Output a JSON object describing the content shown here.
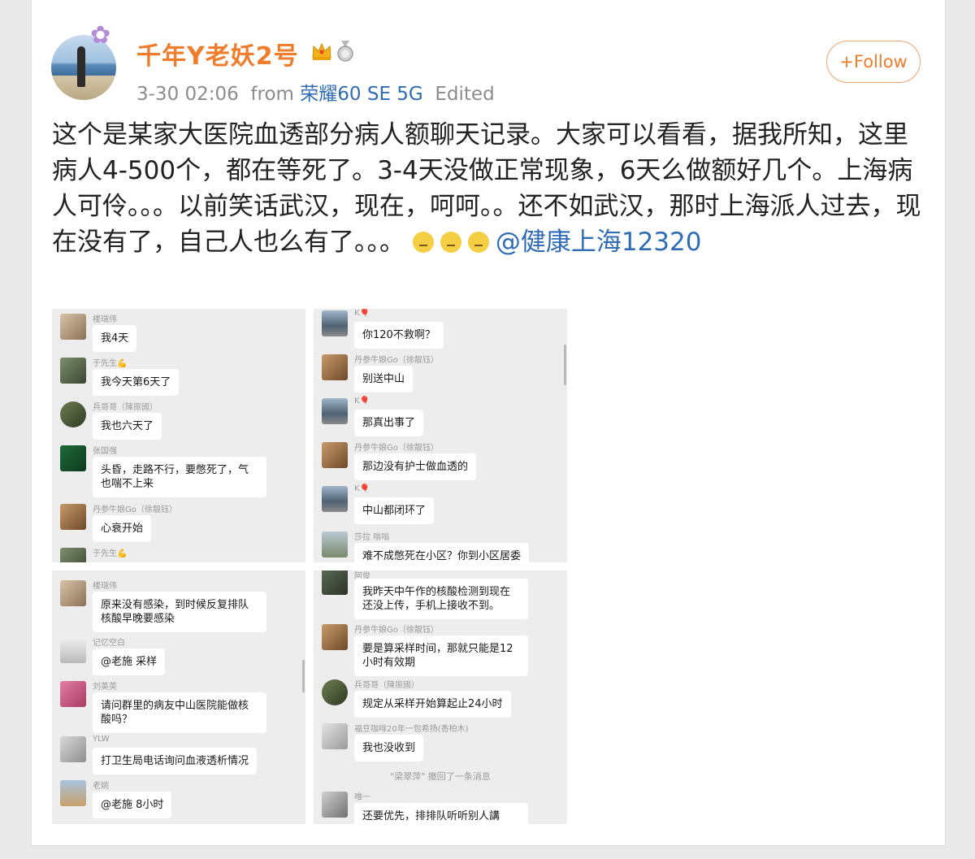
{
  "post": {
    "username": "千年Y老妖2号",
    "time": "3-30 02:06",
    "from_label": "from",
    "source": "荣耀60 SE 5G",
    "edited": "Edited",
    "follow_label": "+Follow",
    "text": "这个是某家大医院血透部分病人额聊天记录。大家可以看看，据我所知，这里病人4-500个，都在等死了。3-4天没做正常现象，6天么做额好几个。上海病人可伶。。。以前笑话武汉，现在，呵呵。。还不如武汉，那时上海派人过去，现在没有了，自己人也么有了。。。",
    "mention": "@健康上海12320"
  },
  "screenshots": [
    {
      "messages": [
        {
          "nick": "楼瑞伟",
          "text": "我4天"
        },
        {
          "nick": "于先生💪",
          "text": "我今天第6天了"
        },
        {
          "nick": "兵哥哥（陳振國）",
          "text": "我也六天了"
        },
        {
          "nick": "张国强",
          "text": "头昏，走路不行，要憋死了，气也喘不上来"
        },
        {
          "nick": "丹参牛娘Go（徐靓钰）",
          "text": "心衰开始"
        },
        {
          "nick": "于先生💪",
          "text": ""
        }
      ]
    },
    {
      "messages": [
        {
          "nick": "K🎈",
          "text": "你120不救啊？"
        },
        {
          "nick": "丹参牛娘Go（徐靓钰）",
          "text": "别送中山"
        },
        {
          "nick": "K🎈",
          "text": "那真出事了"
        },
        {
          "nick": "丹参牛娘Go（徐靓钰）",
          "text": "那边没有护士做血透的"
        },
        {
          "nick": "K🎈",
          "text": "中山都闭环了"
        },
        {
          "nick": "莎拉 嗡嗡",
          "text": "难不成憋死在小区？你到小区居委"
        }
      ]
    },
    {
      "messages": [
        {
          "nick": "楼瑞伟",
          "text": "原来没有感染，到时候反复排队核酸早晚要感染"
        },
        {
          "nick": "记忆空白",
          "text": "@老施  采样"
        },
        {
          "nick": "刘英英",
          "text": "请问群里的病友中山医院能做核酸吗？"
        },
        {
          "nick": "YLW",
          "text": "打卫生局电话询问血液透析情况"
        },
        {
          "nick": "老姚",
          "text": "@老施 8小时"
        }
      ]
    },
    {
      "messages": [
        {
          "nick": "阿俊",
          "text": "我昨天中午作的核酸检测到现在还没上传，手机上接收不到。"
        },
        {
          "nick": "丹参牛娘Go（徐靓钰）",
          "text": "要是算采样时间，那就只能是12小时有效期"
        },
        {
          "nick": "兵哥哥（陳振國）",
          "text": "规定从采样开始算起止24小时"
        },
        {
          "nick": "福豆咖啡20年一包希扬(香柏木)",
          "text": "我也没收到"
        },
        {
          "nick": "唯一",
          "text": "还要优先，排排队听听别人講話，"
        }
      ],
      "system_notice": "\"梁翠萍\" 撤回了一条消息"
    }
  ],
  "colors": {
    "accent": "#ef7d2c",
    "link": "#2f6cb3",
    "chat_bg": "#ededed"
  }
}
